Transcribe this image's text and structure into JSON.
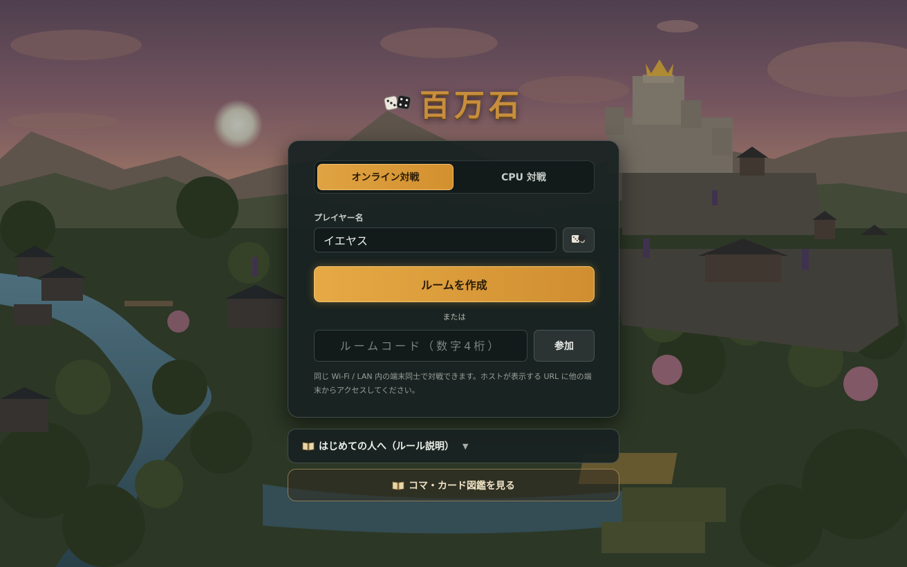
{
  "title": {
    "text": "百万石",
    "icon": "dice-icon"
  },
  "mode_tabs": [
    {
      "label": "オンライン対戦",
      "active": true
    },
    {
      "label": "CPU 対戦",
      "active": false
    }
  ],
  "player": {
    "label": "プレイヤー名",
    "value": "イエヤス",
    "random_icon": "dice-icon"
  },
  "create_button": {
    "label": "ルームを作成"
  },
  "separator": "または",
  "room_code": {
    "placeholder": "ルームコード（数字4桁）",
    "value": ""
  },
  "join_button": {
    "label": "参加"
  },
  "note": "同じ Wi-Fi / LAN 内の端末同士で対戦できます。ホストが表示する URL に他の端末からアクセスしてください。",
  "rules_toggle": {
    "label": "はじめての人へ（ルール説明）",
    "icon": "book-icon",
    "arrow": "▼"
  },
  "catalog_button": {
    "label": "コマ・カード図鑑を見る",
    "icon": "book-icon"
  },
  "colors": {
    "accent": "#e0a342",
    "panel": "#182121",
    "title": "#c88e3c"
  }
}
